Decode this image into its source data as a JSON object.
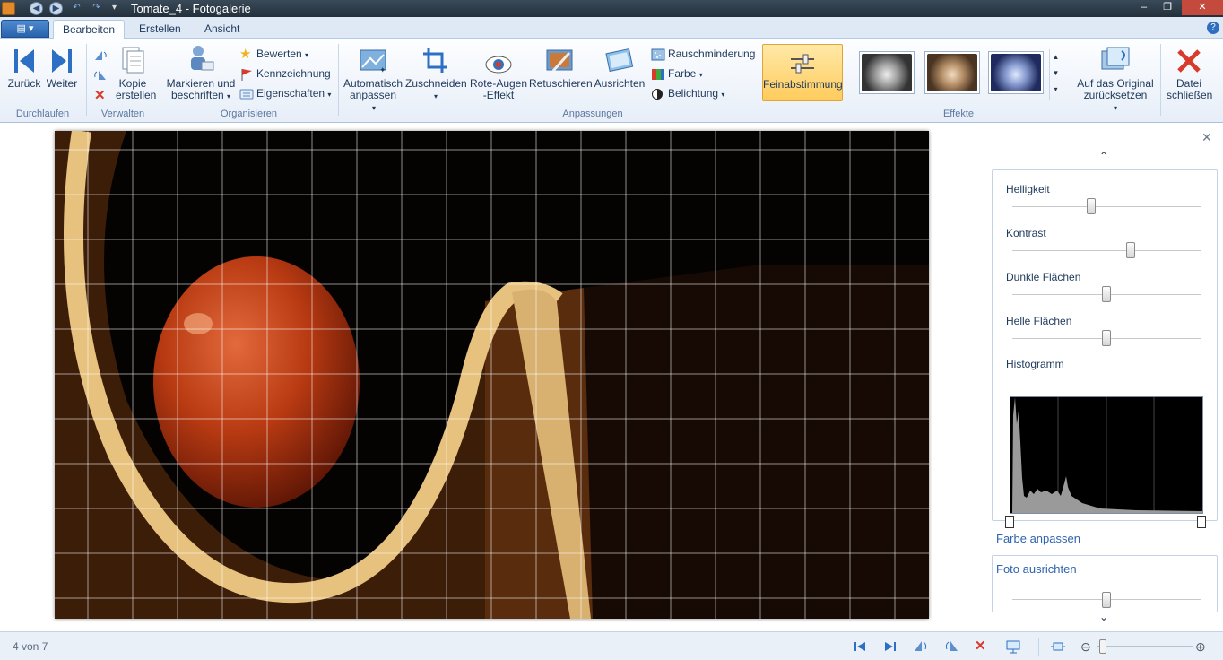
{
  "window": {
    "title": "Tomate_4 - Fotogalerie",
    "controls": [
      "–",
      "❐",
      "✕"
    ]
  },
  "tabs": [
    "Bearbeiten",
    "Erstellen",
    "Ansicht"
  ],
  "active_tab": "Bearbeiten",
  "ribbon": {
    "durchlaufen": {
      "label": "Durchlaufen",
      "zurueck": "Zurück",
      "weiter": "Weiter"
    },
    "verwalten": {
      "label": "Verwalten",
      "kopie": "Kopie erstellen"
    },
    "organisieren": {
      "label": "Organisieren",
      "markieren": "Markieren und beschriften",
      "bewerten": "Bewerten",
      "kennzeichnung": "Kennzeichnung",
      "eigenschaften": "Eigenschaften"
    },
    "anpassungen": {
      "label": "Anpassungen",
      "automatisch": "Automatisch anpassen",
      "zuschneiden": "Zuschneiden",
      "roteaugen": "Rote-Augen -Effekt",
      "retuschieren": "Retuschieren",
      "ausrichten": "Ausrichten",
      "rauschminderung": "Rauschminderung",
      "farbe": "Farbe",
      "belichtung": "Belichtung",
      "feinabstimmung": "Feinabstimmung"
    },
    "effekte": {
      "label": "Effekte"
    },
    "original": "Auf das Original zurücksetzen",
    "schliessen": "Datei schließen"
  },
  "panel": {
    "sliders": [
      {
        "label": "Helligkeit",
        "value": 0.42
      },
      {
        "label": "Kontrast",
        "value": 0.63
      },
      {
        "label": "Dunkle Flächen",
        "value": 0.5
      },
      {
        "label": "Helle Flächen",
        "value": 0.5
      }
    ],
    "histogram_label": "Histogramm",
    "farbe_anpassen": "Farbe anpassen",
    "foto_ausrichten": "Foto ausrichten",
    "ausrichten_value": 0.5
  },
  "status": {
    "counter": "4 von 7"
  },
  "colors": {
    "accent": "#2f64ae",
    "ribbon_active": "#ffcb5c"
  }
}
